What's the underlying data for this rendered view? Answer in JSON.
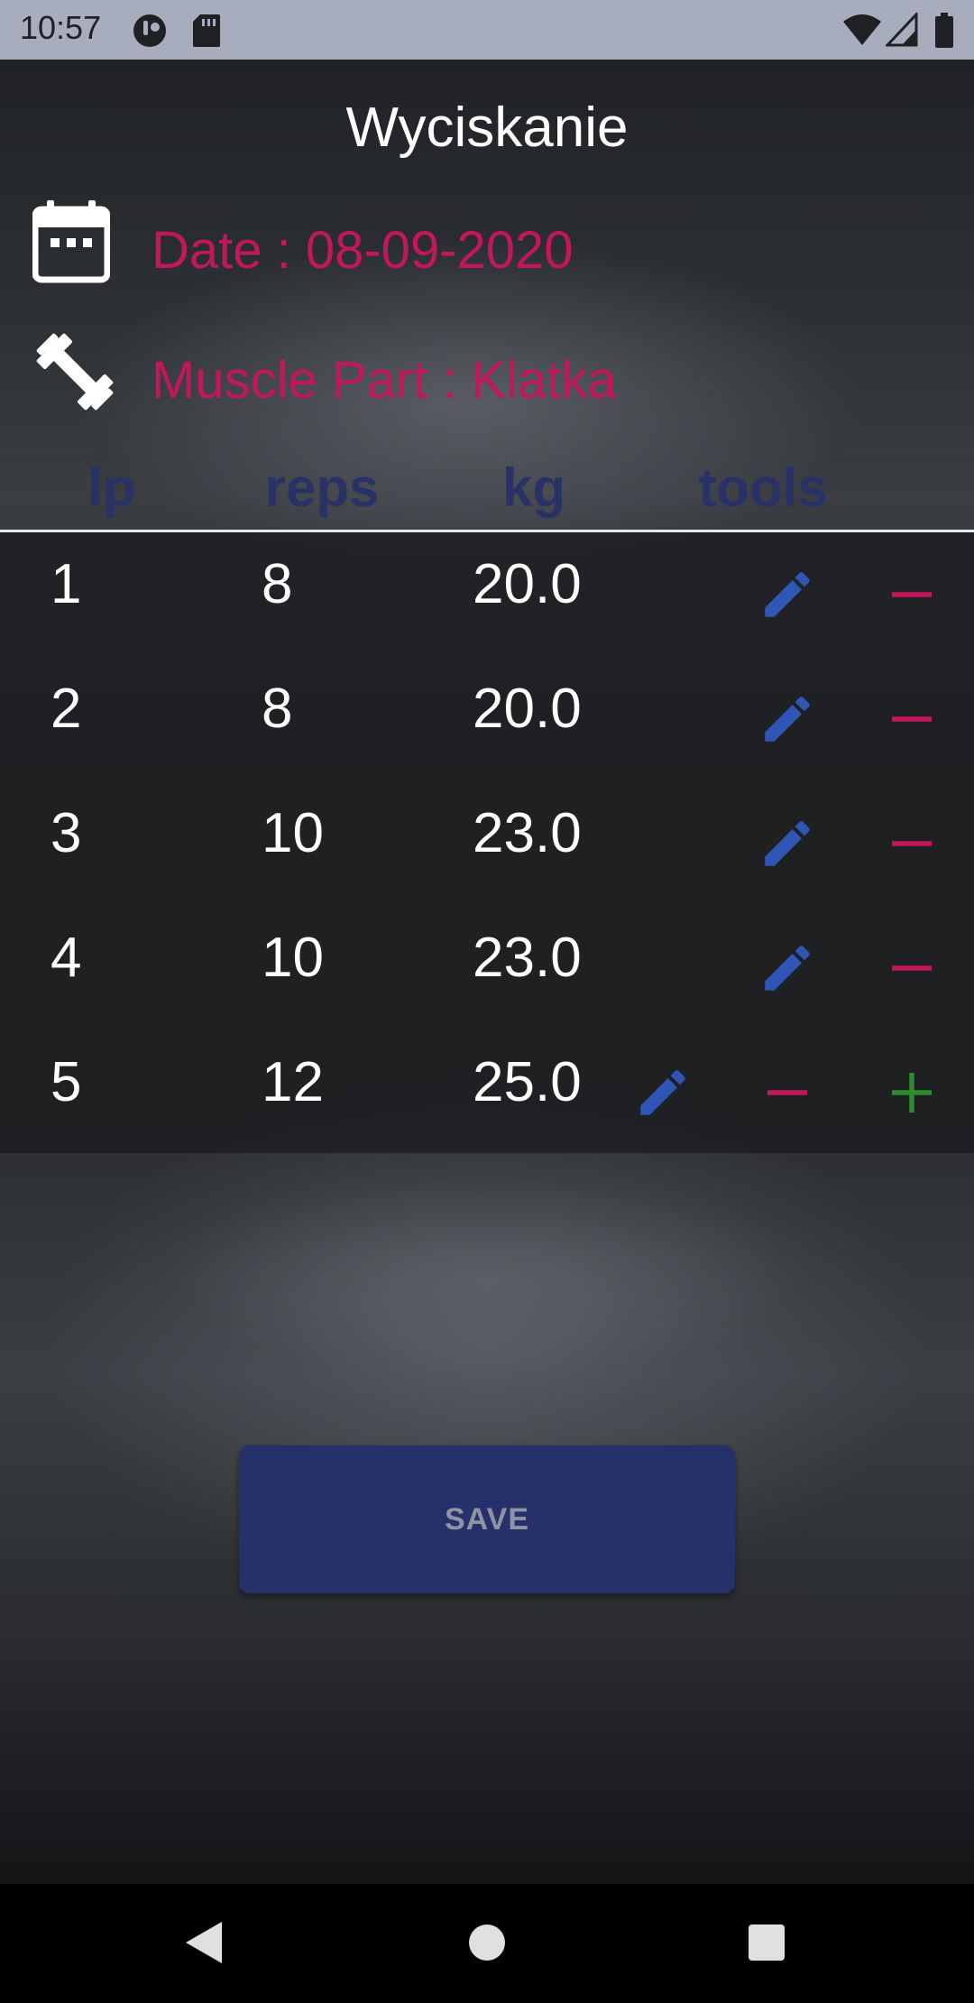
{
  "status_bar": {
    "time": "10:57",
    "icons": [
      "app-notification-icon",
      "sd-card-icon",
      "wifi-icon",
      "signal-icon",
      "battery-icon"
    ]
  },
  "screen": {
    "title": "Wyciskanie",
    "date_text": "Date : 08-09-2020",
    "muscle_text": "Muscle Part : Klatka"
  },
  "table": {
    "columns": [
      "lp",
      "reps",
      "kg",
      "tools"
    ],
    "rows": [
      {
        "lp": "1",
        "reps": "8",
        "kg": "20.0"
      },
      {
        "lp": "2",
        "reps": "8",
        "kg": "20.0"
      },
      {
        "lp": "3",
        "reps": "10",
        "kg": "23.0"
      },
      {
        "lp": "4",
        "reps": "10",
        "kg": "23.0"
      },
      {
        "lp": "5",
        "reps": "12",
        "kg": "25.0"
      }
    ]
  },
  "actions": {
    "save_label": "SAVE"
  },
  "colors": {
    "accent_pink": "#c2185b",
    "header_blue": "#283266",
    "edit_blue": "#2f55b5",
    "add_green": "#2e8b2e",
    "button_bg": "#26306a"
  },
  "nav": {
    "icons": [
      "back-icon",
      "home-icon",
      "recents-icon"
    ]
  }
}
